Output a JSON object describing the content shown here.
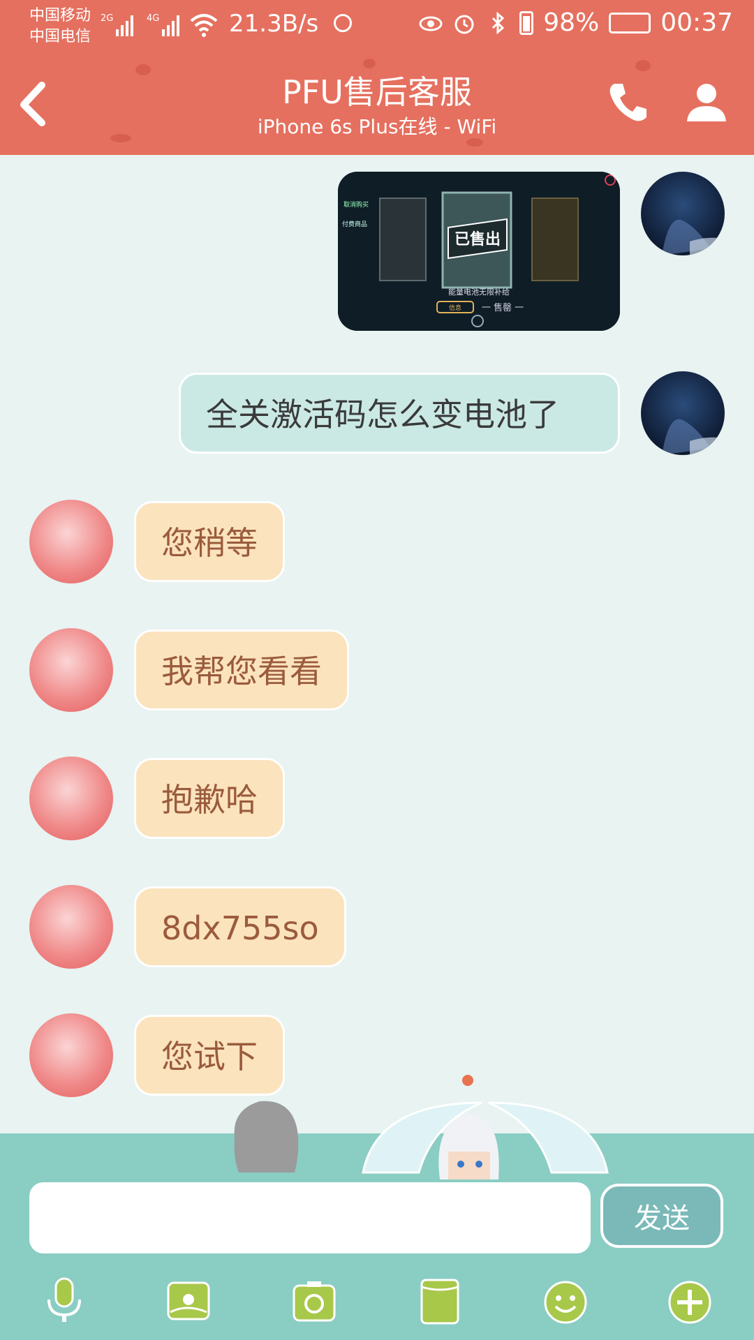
{
  "status_bar": {
    "carrier_1": "中国移动",
    "carrier_2": "中国电信",
    "sig1_label": "2G",
    "sig2_label": "4G",
    "net_speed": "21.3B/s",
    "battery": "98%",
    "time": "00:37"
  },
  "header": {
    "title": "PFU售后客服",
    "subtitle": "iPhone 6s Plus在线 - WiFi"
  },
  "messages": [
    {
      "sender": "me",
      "type": "image"
    },
    {
      "sender": "me",
      "type": "text",
      "text": "全关激活码怎么变电池了"
    },
    {
      "sender": "cs",
      "type": "text",
      "text": "您稍等"
    },
    {
      "sender": "cs",
      "type": "text",
      "text": "我帮您看看"
    },
    {
      "sender": "cs",
      "type": "text",
      "text": "抱歉哈"
    },
    {
      "sender": "cs",
      "type": "text",
      "text": "8dx755so"
    },
    {
      "sender": "cs",
      "type": "text",
      "text": "您试下"
    }
  ],
  "image_msg": {
    "menu_1": "取消购买",
    "menu_2": "付费商品",
    "sold_label": "已售出",
    "caption": "能量电池无限补给",
    "button_label": "信息",
    "footer_label": "一 售罄 一"
  },
  "input": {
    "value": "",
    "send_label": "发送"
  },
  "toolbar": {
    "icons": [
      "microphone-icon",
      "image-icon",
      "camera-icon",
      "file-icon",
      "emoji-icon",
      "plus-icon"
    ]
  },
  "colors": {
    "header_bg": "#e5705f",
    "chat_bg": "#e8f3f2",
    "my_bubble": "#cbe9e4",
    "cs_bubble": "#fbe3be",
    "bottom_bg": "#8acdc3",
    "icon_green": "#a8c84a"
  }
}
